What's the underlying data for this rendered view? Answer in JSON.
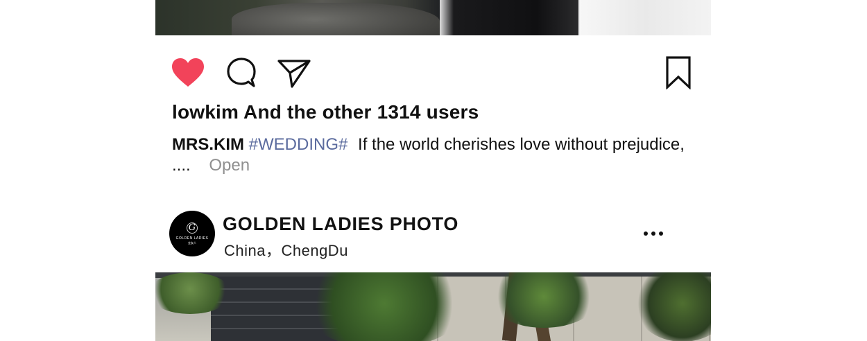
{
  "post_previous": {
    "photo": {
      "alt_icon": "wedding-photo"
    },
    "actions": {
      "like_icon": "heart-filled-icon",
      "like_color": "#f2435a",
      "comment_icon": "comment-icon",
      "share_icon": "send-icon",
      "save_icon": "bookmark-icon"
    },
    "likes_text": "lowkim And the other 1314 users",
    "caption": {
      "username": "MRS.KIM",
      "hashtag": "#WEDDING#",
      "text": "If the world cherishes love without prejudice, ....",
      "open_label": "Open",
      "hashtag_color": "#5b6b9e"
    }
  },
  "post_next": {
    "account": {
      "avatar_mark": "G",
      "avatar_brand": "GOLDEN LADIES",
      "name": "GOLDEN LADIES PHOTO",
      "location": "China，ChengDu"
    },
    "more_icon": "more-horizontal-icon",
    "photo": {
      "alt_icon": "garden-photo"
    }
  }
}
